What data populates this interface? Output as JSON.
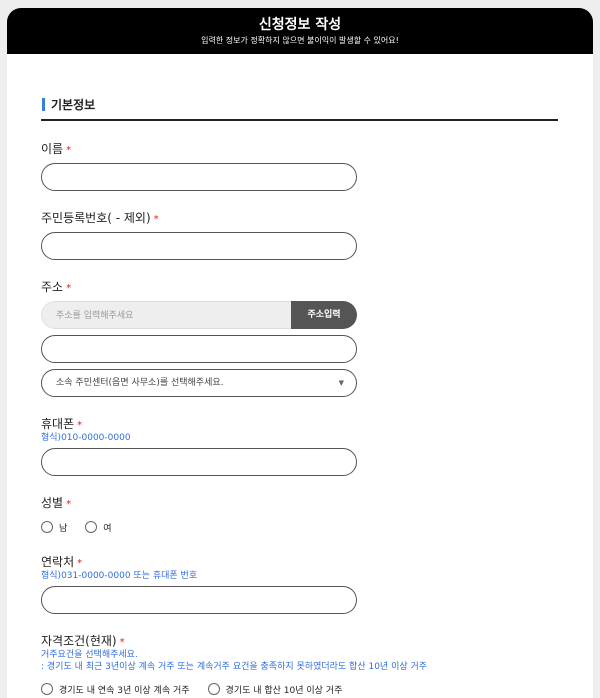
{
  "header": {
    "title": "신청정보 작성",
    "subtitle": "입력한 정보가 정확하지 않으면 불이익이 발생할 수 있어요!"
  },
  "section": {
    "title": "기본정보"
  },
  "fields": {
    "name": {
      "label": "이름",
      "required": "*"
    },
    "rrn": {
      "label": "주민등록번호( - 제외)",
      "required": "*"
    },
    "address": {
      "label": "주소",
      "required": "*",
      "search_placeholder": "주소를 입력해주세요",
      "search_button": "주소입력",
      "center_select": "소속 주민센터(읍면 사무소)를 선택해주세요."
    },
    "phone": {
      "label": "휴대폰",
      "required": "*",
      "hint": "형식)010-0000-0000"
    },
    "gender": {
      "label": "성별",
      "required": "*",
      "options": [
        "남",
        "여"
      ]
    },
    "contact": {
      "label": "연락처",
      "required": "*",
      "hint": "형식)031-0000-0000 또는 휴대폰 번호"
    },
    "qualification": {
      "label": "자격조건(현재)",
      "required": "*",
      "hint1": "거주요건을 선택해주세요.",
      "hint2": ": 경기도 내 최근 3년이상 계속 거주 또는 계속거주 요건을 충족하지 못하였더라도 합산 10년 이상 거주",
      "options": [
        "경기도 내 연속 3년 이상 계속 거주",
        "경기도 내 합산 10년 이상 거주"
      ]
    }
  },
  "colors": {
    "header_bg": "#000000",
    "required": "#e02020",
    "hint": "#2f6ee0",
    "accent": "#3a7fd5"
  }
}
